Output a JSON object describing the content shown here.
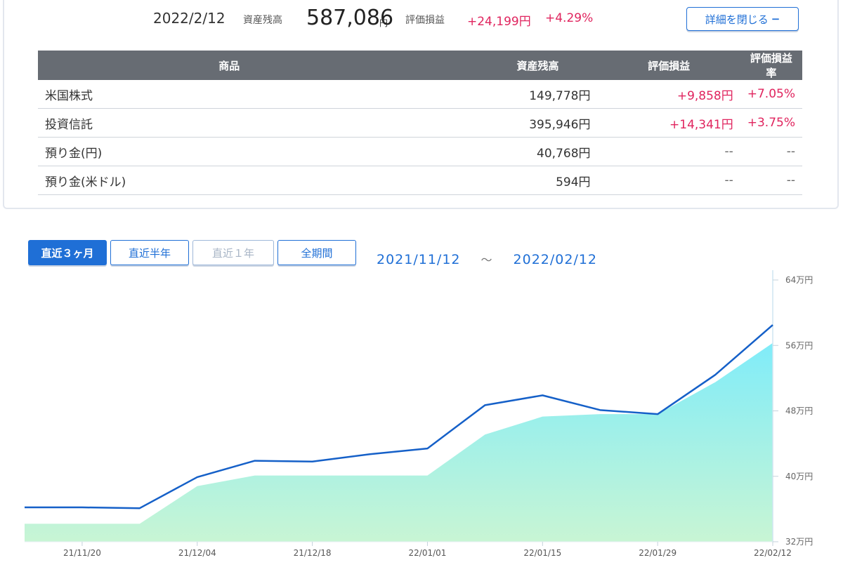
{
  "summary": {
    "date": "2022/2/12",
    "balance_label": "資産残高",
    "balance_value": "587,086",
    "balance_unit": "円",
    "pl_label": "評価損益",
    "pl_value": "+24,199円",
    "pl_rate": "+4.29%",
    "close_button_label": "詳細を閉じる",
    "close_button_mark": "−"
  },
  "holdings": {
    "headers": [
      "商品",
      "資産残高",
      "評価損益",
      "評価損益率"
    ],
    "rows": [
      {
        "name": "米国株式",
        "balance": "149,778円",
        "pl": "+9,858円",
        "rate": "+7.05%"
      },
      {
        "name": "投資信託",
        "balance": "395,946円",
        "pl": "+14,341円",
        "rate": "+3.75%"
      },
      {
        "name": "預り金(円)",
        "balance": "40,768円",
        "pl": "--",
        "rate": "--"
      },
      {
        "name": "預り金(米ドル)",
        "balance": "594円",
        "pl": "--",
        "rate": "--"
      }
    ]
  },
  "period_tabs": [
    {
      "label": "直近３ヶ月",
      "state": "active"
    },
    {
      "label": "直近半年",
      "state": "normal"
    },
    {
      "label": "直近１年",
      "state": "disabled"
    },
    {
      "label": "全期間",
      "state": "normal"
    }
  ],
  "date_range": {
    "from": "2021/11/12",
    "separator": "～",
    "to": "2022/02/12"
  },
  "chart_data": {
    "type": "area",
    "x": [
      "21/11/12",
      "21/11/20",
      "21/11/27",
      "21/12/04",
      "21/12/11",
      "21/12/18",
      "21/12/25",
      "22/01/01",
      "22/01/08",
      "22/01/15",
      "22/01/22",
      "22/01/29",
      "22/02/05",
      "22/02/12"
    ],
    "x_tick_labels": [
      "21/11/20",
      "21/12/04",
      "21/12/18",
      "22/01/01",
      "22/01/15",
      "22/01/29",
      "22/02/12"
    ],
    "series": [
      {
        "values": [
          36.2,
          36.2,
          36.1,
          39.9,
          41.9,
          41.8,
          42.7,
          43.4,
          48.7,
          49.9,
          48.1,
          47.6,
          52.4,
          58.5
        ]
      },
      {
        "values": [
          34.2,
          34.2,
          34.2,
          38.8,
          40.1,
          40.1,
          40.1,
          40.1,
          45.1,
          47.3,
          47.6,
          47.6,
          51.5,
          56.3
        ]
      }
    ],
    "y_tick_labels": [
      "32万円",
      "40万円",
      "48万円",
      "56万円",
      "64万円"
    ],
    "ylim": [
      32,
      64
    ],
    "colors": {
      "line": "#1560c8",
      "area_top": "#80ecf9",
      "area_bottom": "#c8f5d4",
      "axis": "#cfe6f2"
    }
  }
}
